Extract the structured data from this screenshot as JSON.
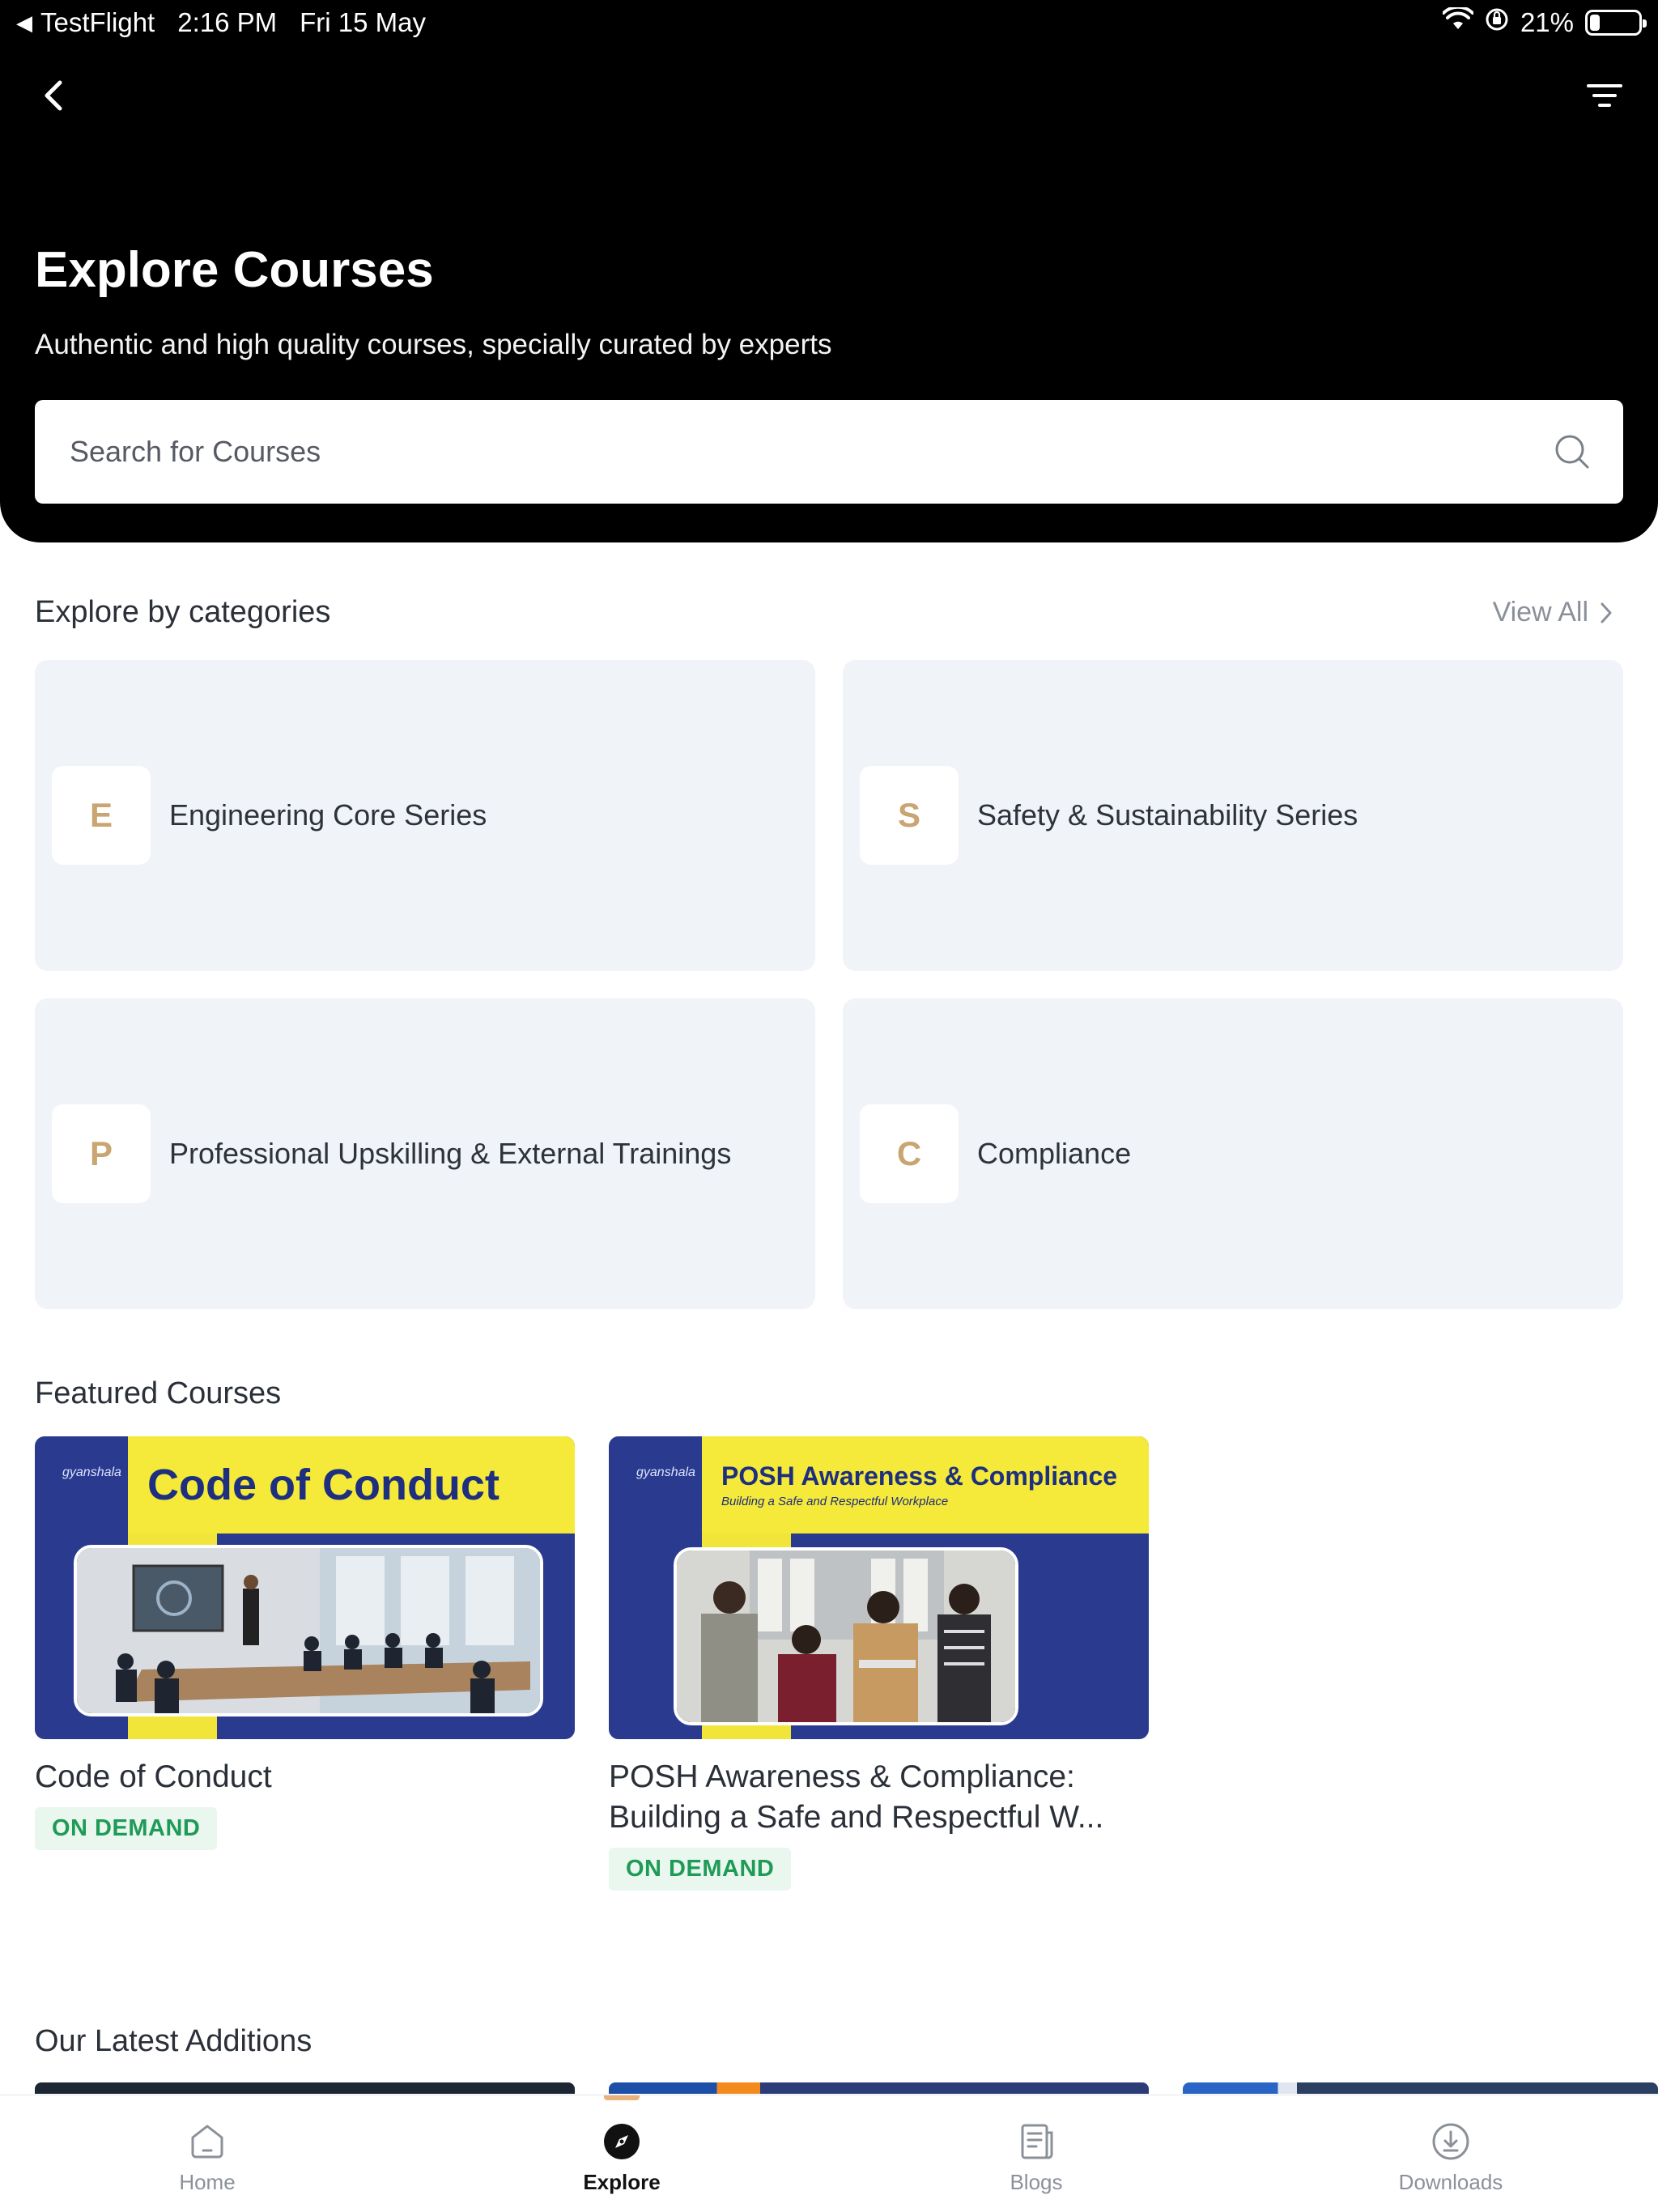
{
  "status_bar": {
    "back_app": "TestFlight",
    "time": "2:16 PM",
    "date": "Fri 15 May",
    "battery": "21%",
    "battery_level": 0.21
  },
  "header": {
    "title": "Explore Courses",
    "subtitle": "Authentic and high quality courses, specially curated by experts",
    "search_placeholder": "Search for Courses"
  },
  "categories": {
    "title": "Explore by categories",
    "view_all": "View All",
    "items": [
      {
        "letter": "E",
        "label": "Engineering Core Series"
      },
      {
        "letter": "S",
        "label": "Safety & Sustainability Series"
      },
      {
        "letter": "P",
        "label": "Professional Upskilling & External Trainings"
      },
      {
        "letter": "C",
        "label": "Compliance"
      }
    ]
  },
  "featured": {
    "title": "Featured Courses",
    "courses": [
      {
        "thumb_brand": "gyanshala",
        "thumb_heading": "Code of Conduct",
        "title": "Code of Conduct",
        "badge": "ON DEMAND"
      },
      {
        "thumb_brand": "gyanshala",
        "thumb_heading": "POSH Awareness & Compliance",
        "thumb_subheading": "Building a Safe and Respectful Workplace",
        "title_line1": "POSH Awareness & Compliance:",
        "title_line2": "Building a Safe and Respectful W...",
        "badge": "ON DEMAND"
      }
    ]
  },
  "latest": {
    "title": "Our Latest Additions"
  },
  "tabbar": {
    "tabs": [
      {
        "label": "Home"
      },
      {
        "label": "Explore"
      },
      {
        "label": "Blogs"
      },
      {
        "label": "Downloads"
      }
    ]
  },
  "colors": {
    "accent_gold": "#c9a571",
    "chip_green": "#1f9a57",
    "card_bg": "#f0f3f7",
    "thumb_blue": "#2a3b8f",
    "thumb_yellow": "#f5e93a"
  }
}
